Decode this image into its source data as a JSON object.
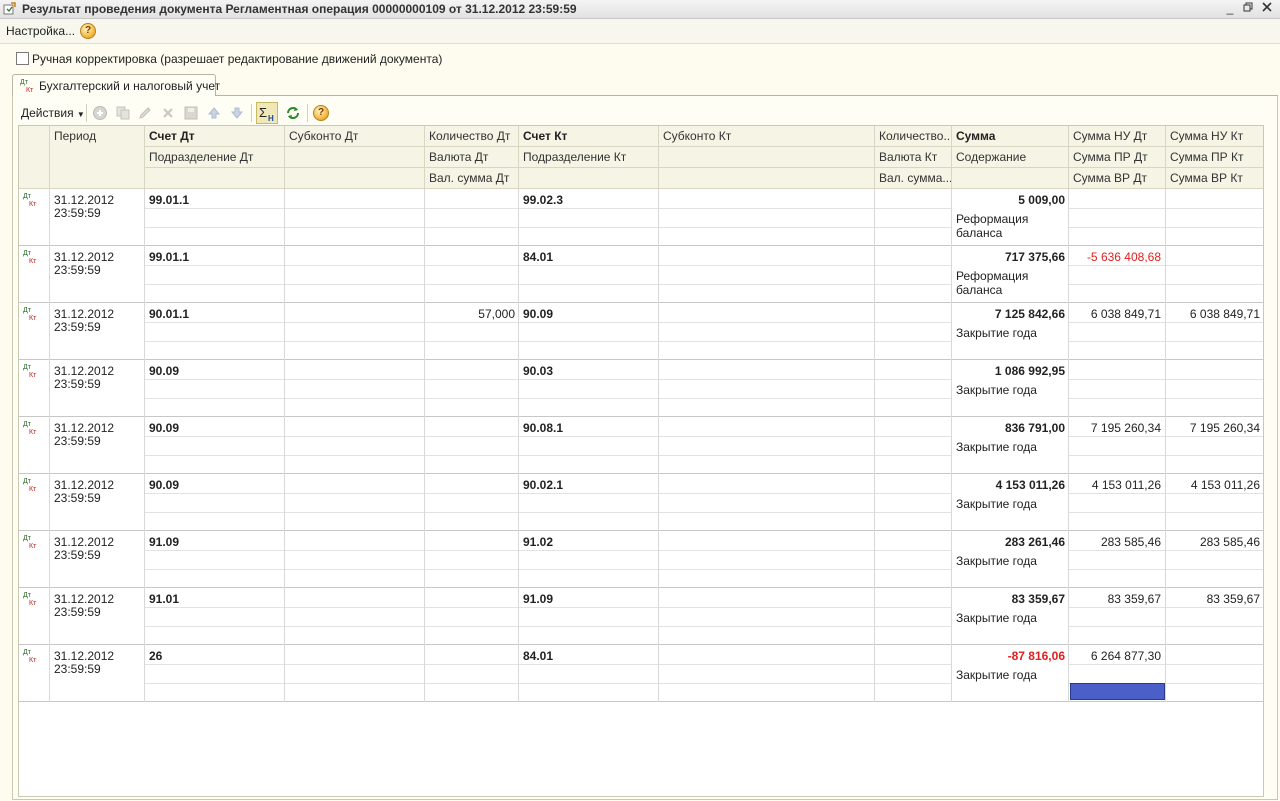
{
  "window": {
    "title": "Результат проведения документа Регламентная операция 00000000109 от 31.12.2012 23:59:59"
  },
  "menu": {
    "settings": "Настройка..."
  },
  "manual_correction": {
    "label": "Ручная корректировка (разрешает редактирование движений документа)"
  },
  "tab": {
    "label": "Бухгалтерский и налоговый учет"
  },
  "toolbar": {
    "actions": "Действия"
  },
  "headers": {
    "period": "Период",
    "account_dt": "Счет Дт",
    "subconto_dt": "Субконто Дт",
    "quantity_dt": "Количество Дт",
    "account_kt": "Счет Кт",
    "subconto_kt": "Субконто Кт",
    "quantity_kt": "Количество...",
    "sum": "Сумма",
    "sum_nu_dt": "Сумма НУ Дт",
    "sum_nu_kt": "Сумма НУ Кт",
    "division_dt": "Подразделение Дт",
    "currency_dt": "Валюта Дт",
    "division_kt": "Подразделение Кт",
    "currency_kt": "Валюта Кт",
    "content": "Содержание",
    "sum_pr_dt": "Сумма ПР Дт",
    "sum_pr_kt": "Сумма ПР Кт",
    "cur_sum_dt": "Вал. сумма Дт",
    "cur_sum_kt": "Вал. сумма...",
    "sum_vr_dt": "Сумма ВР Дт",
    "sum_vr_kt": "Сумма ВР Кт"
  },
  "rows": [
    {
      "date": "31.12.2012",
      "time": "23:59:59",
      "acc_dt": "99.01.1",
      "qty_dt": "",
      "acc_kt": "99.02.3",
      "sum": "5 009,00",
      "sum_red": false,
      "content": "Реформация баланса",
      "nu_dt": "",
      "nu_dt_red": false,
      "nu_kt": ""
    },
    {
      "date": "31.12.2012",
      "time": "23:59:59",
      "acc_dt": "99.01.1",
      "qty_dt": "",
      "acc_kt": "84.01",
      "sum": "717 375,66",
      "sum_red": false,
      "content": "Реформация баланса",
      "nu_dt": "-5 636 408,68",
      "nu_dt_red": true,
      "nu_kt": ""
    },
    {
      "date": "31.12.2012",
      "time": "23:59:59",
      "acc_dt": "90.01.1",
      "qty_dt": "57,000",
      "acc_kt": "90.09",
      "sum": "7 125 842,66",
      "sum_red": false,
      "content": "Закрытие года",
      "nu_dt": "6 038 849,71",
      "nu_dt_red": false,
      "nu_kt": "6 038 849,71"
    },
    {
      "date": "31.12.2012",
      "time": "23:59:59",
      "acc_dt": "90.09",
      "qty_dt": "",
      "acc_kt": "90.03",
      "sum": "1 086 992,95",
      "sum_red": false,
      "content": "Закрытие года",
      "nu_dt": "",
      "nu_dt_red": false,
      "nu_kt": ""
    },
    {
      "date": "31.12.2012",
      "time": "23:59:59",
      "acc_dt": "90.09",
      "qty_dt": "",
      "acc_kt": "90.08.1",
      "sum": "836 791,00",
      "sum_red": false,
      "content": "Закрытие года",
      "nu_dt": "7 195 260,34",
      "nu_dt_red": false,
      "nu_kt": "7 195 260,34"
    },
    {
      "date": "31.12.2012",
      "time": "23:59:59",
      "acc_dt": "90.09",
      "qty_dt": "",
      "acc_kt": "90.02.1",
      "sum": "4 153 011,26",
      "sum_red": false,
      "content": "Закрытие года",
      "nu_dt": "4 153 011,26",
      "nu_dt_red": false,
      "nu_kt": "4 153 011,26"
    },
    {
      "date": "31.12.2012",
      "time": "23:59:59",
      "acc_dt": "91.09",
      "qty_dt": "",
      "acc_kt": "91.02",
      "sum": "283 261,46",
      "sum_red": false,
      "content": "Закрытие года",
      "nu_dt": "283 585,46",
      "nu_dt_red": false,
      "nu_kt": "283 585,46"
    },
    {
      "date": "31.12.2012",
      "time": "23:59:59",
      "acc_dt": "91.01",
      "qty_dt": "",
      "acc_kt": "91.09",
      "sum": "83 359,67",
      "sum_red": false,
      "content": "Закрытие года",
      "nu_dt": "83 359,67",
      "nu_dt_red": false,
      "nu_kt": "83 359,67"
    },
    {
      "date": "31.12.2012",
      "time": "23:59:59",
      "acc_dt": "26",
      "qty_dt": "",
      "acc_kt": "84.01",
      "sum": "-87 816,06",
      "sum_red": true,
      "content": "Закрытие года",
      "nu_dt": "6 264 877,30",
      "nu_dt_red": false,
      "nu_kt": ""
    }
  ],
  "colors": {
    "accent": "#6a5a00",
    "negative": "#e02020",
    "selection": "#4a5fc8"
  }
}
